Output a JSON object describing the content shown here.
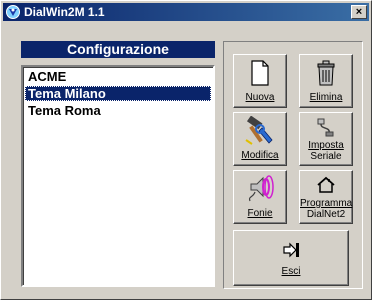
{
  "window": {
    "title": "DialWin2M 1.1",
    "close_glyph": "×"
  },
  "config_panel": {
    "title": "Configurazione",
    "items": [
      {
        "label": "ACME",
        "selected": false
      },
      {
        "label": "Tema Milano",
        "selected": true
      },
      {
        "label": "Tema Roma",
        "selected": false
      }
    ]
  },
  "buttons": {
    "nuova": {
      "label": "Nuova",
      "icon": "new-document-icon"
    },
    "elimina": {
      "label": "Elimina",
      "icon": "trash-can-icon"
    },
    "modifica": {
      "label": "Modifica",
      "icon": "hammer-wrench-icon"
    },
    "imposta_seriale": {
      "line1": "Imposta",
      "line2": "Seriale",
      "icon": "serial-cable-icon"
    },
    "fonie": {
      "label": "Fonie",
      "icon": "speaker-sound-icon"
    },
    "programma_dialnet2": {
      "line1": "Programma",
      "line2": "DialNet2",
      "icon": "house-arrow-icon"
    },
    "esci": {
      "label": "Esci",
      "icon": "exit-door-icon"
    }
  }
}
